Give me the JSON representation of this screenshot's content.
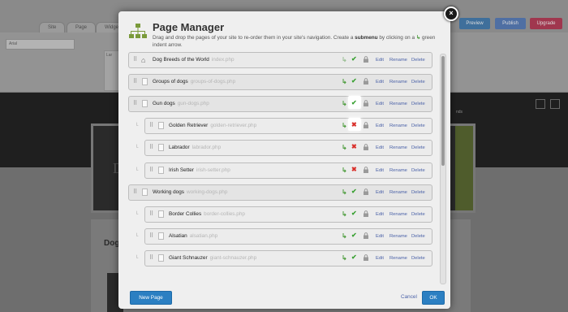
{
  "background": {
    "tabs": [
      "Site",
      "Page",
      "Widge"
    ],
    "font_select": "Arial",
    "side_panel_label": "Lar",
    "buttons": [
      {
        "label": "Preview",
        "color": "#3f6f9b"
      },
      {
        "label": "Publish",
        "color": "#4f6fa3"
      },
      {
        "label": "Upgrade",
        "color": "#a0374e"
      }
    ],
    "hero_letter": "D",
    "content_heading": "Dog",
    "side_text": "nds"
  },
  "modal": {
    "title": "Page Manager",
    "description_prefix": "Drag and drop the pages of your site to re-order them in your site's navigation. Create a ",
    "description_bold": "submenu",
    "description_middle": " by clicking on a ",
    "description_suffix": " green indent arrow.",
    "close_label": "×",
    "actions": {
      "edit": "Edit",
      "rename": "Rename",
      "delete": "Delete"
    },
    "new_page_label": "New Page",
    "cancel_label": "Cancel",
    "ok_label": "OK"
  },
  "pages": [
    {
      "name": "Dog Breeds of the World",
      "file": "index.php",
      "level": 0,
      "home": true,
      "status": "check",
      "indent": false
    },
    {
      "name": "Groups of dogs",
      "file": "groups-of-dogs.php",
      "level": 0,
      "home": false,
      "status": "check",
      "indent": true
    },
    {
      "name": "Gun dogs",
      "file": "gun-dogs.php",
      "level": 0,
      "home": false,
      "status": "check",
      "indent": true,
      "highlight": true
    },
    {
      "name": "Golden Retriever",
      "file": "golden-retriever.php",
      "level": 1,
      "home": false,
      "status": "cross",
      "indent": true,
      "highlight": true
    },
    {
      "name": "Labrador",
      "file": "labrador.php",
      "level": 1,
      "home": false,
      "status": "cross",
      "indent": true
    },
    {
      "name": "Irish Setter",
      "file": "irish-setter.php",
      "level": 1,
      "home": false,
      "status": "cross",
      "indent": true
    },
    {
      "name": "Working dogs",
      "file": "working-dogs.php",
      "level": 0,
      "home": false,
      "status": "check",
      "indent": true
    },
    {
      "name": "Border Collies",
      "file": "border-collies.php",
      "level": 1,
      "home": false,
      "status": "check",
      "indent": true
    },
    {
      "name": "Alsatian",
      "file": "alsatian.php",
      "level": 1,
      "home": false,
      "status": "check",
      "indent": true
    },
    {
      "name": "Giant Schnauzer",
      "file": "giant-schnauzer.php",
      "level": 1,
      "home": false,
      "status": "check",
      "indent": true
    }
  ],
  "icons": {
    "indent": "green-indent-arrow-icon",
    "check": "check-icon",
    "cross": "cross-icon",
    "lock": "lock-icon",
    "home": "home-icon",
    "page": "page-icon",
    "grip": "drag-handle-icon"
  },
  "colors": {
    "accent_blue": "#2b7fc2",
    "link": "#4b62a8",
    "check_green": "#3aa133",
    "cross_red": "#d9302b"
  }
}
